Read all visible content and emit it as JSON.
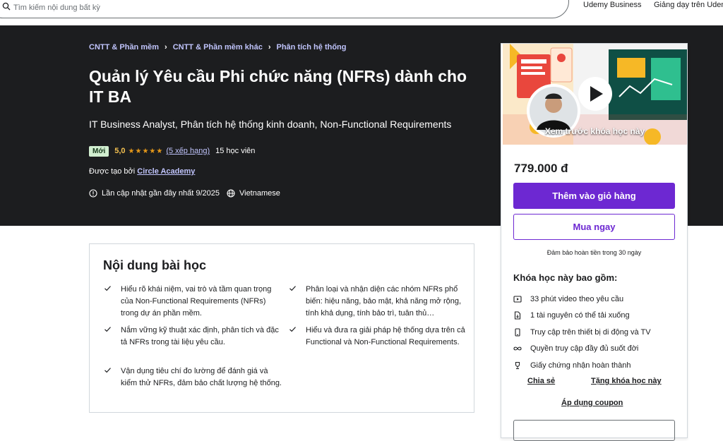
{
  "header": {
    "search_placeholder": "Tìm kiếm nội dung bất kỳ",
    "nav": [
      "Udemy Business",
      "Giảng dạy trên Udemy"
    ]
  },
  "hero": {
    "breadcrumb": [
      "CNTT & Phần mềm",
      "CNTT & Phần mềm khác",
      "Phân tích hệ thống"
    ],
    "title": "Quản lý Yêu cầu Phi chức năng (NFRs) dành cho IT BA",
    "subtitle": "IT Business Analyst, Phân tích hệ thống kinh doanh, Non-Functional Requirements",
    "badge": "Mới",
    "rating_value": "5,0",
    "stars": "★★★★★",
    "rating_count": "(5 xếp hạng)",
    "students": "15 học viên",
    "instructor_prefix": "Được tạo bởi",
    "instructor_name": "Circle Academy",
    "last_updated": "Lần cập nhật gần đây nhất 9/2025",
    "language": "Vietnamese"
  },
  "card": {
    "preview_label": "Xem trước khóa học này",
    "price": "779.000 đ",
    "add_to_cart": "Thêm vào giỏ hàng",
    "buy_now": "Mua ngay",
    "guarantee": "Đảm bảo hoàn tiền trong 30 ngày",
    "includes_title": "Khóa học này bao gồm:",
    "includes": [
      {
        "icon": "video-icon",
        "text": "33 phút video theo yêu cầu"
      },
      {
        "icon": "file-download-icon",
        "text": "1 tài nguyên có thể tải xuống"
      },
      {
        "icon": "mobile-icon",
        "text": "Truy cập trên thiết bị di động và TV"
      },
      {
        "icon": "infinity-icon",
        "text": "Quyền truy cập đầy đủ suốt đời"
      },
      {
        "icon": "trophy-icon",
        "text": "Giấy chứng nhận hoàn thành"
      }
    ],
    "share": "Chia sẻ",
    "gift": "Tặng khóa học này",
    "coupon": "Áp dụng coupon",
    "colors": {
      "primary": "#6d28d2",
      "link": "#c0c4fc",
      "star": "#e59819"
    }
  },
  "learn": {
    "title": "Nội dung bài học",
    "items": [
      "Hiểu rõ khái niệm, vai trò và tầm quan trọng của Non-Functional Requirements (NFRs) trong dự án phần mềm.",
      "Phân loại và nhận diện các nhóm NFRs phổ biến: hiệu năng, bảo mật, khả năng mở rộng, tính khả dụng, tính bảo trì, tuân thủ…",
      "Nắm vững kỹ thuật xác định, phân tích và đặc tả NFRs trong tài liệu yêu cầu.",
      "Hiểu và đưa ra giải pháp hệ thống dựa trên cả Functional và Non-Functional Requirements.",
      "Vận dụng tiêu chí đo lường để đánh giá và kiểm thử NFRs, đảm bảo chất lượng hệ thống."
    ]
  }
}
